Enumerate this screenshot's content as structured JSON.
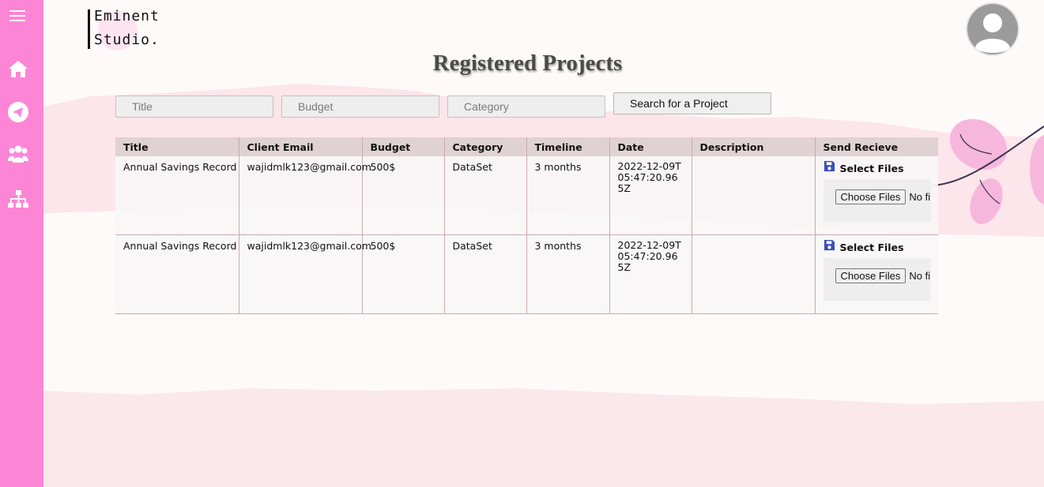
{
  "brand": {
    "line1": "Eminent",
    "line2": "Studio."
  },
  "page": {
    "title": "Registered Projects"
  },
  "sidebar": {
    "items": [
      {
        "icon": "menu-icon"
      },
      {
        "icon": "home-icon"
      },
      {
        "icon": "send-icon"
      },
      {
        "icon": "users-icon"
      },
      {
        "icon": "sitemap-icon"
      }
    ]
  },
  "search": {
    "title_placeholder": "Title",
    "budget_placeholder": "Budget",
    "category_placeholder": "Category",
    "button_label": "Search for a Project"
  },
  "table": {
    "headers": [
      "Title",
      "Client Email",
      "Budget",
      "Category",
      "Timeline",
      "Date",
      "Description",
      "Send Recieve"
    ],
    "rows": [
      {
        "title": "Annual Savings Record",
        "email": "wajidmlk123@gmail.com",
        "budget": "500$",
        "category": "DataSet",
        "timeline": "3 months",
        "date": "2022-12-09T05:47:20.965Z",
        "description": "",
        "send_label": "Select Files",
        "file_button": "Choose Files",
        "file_status": "No file chosen"
      },
      {
        "title": "Annual Savings Record",
        "email": "wajidmlk123@gmail.com",
        "budget": "500$",
        "category": "DataSet",
        "timeline": "3 months",
        "date": "2022-12-09T05:47:20.965Z",
        "description": "",
        "send_label": "Select Files",
        "file_button": "Choose Files",
        "file_status": "No file chosen"
      }
    ]
  },
  "colors": {
    "sidebar": "#fd85d6",
    "accent_pink": "#f7b7dc",
    "save_icon": "#3b4fb8"
  }
}
